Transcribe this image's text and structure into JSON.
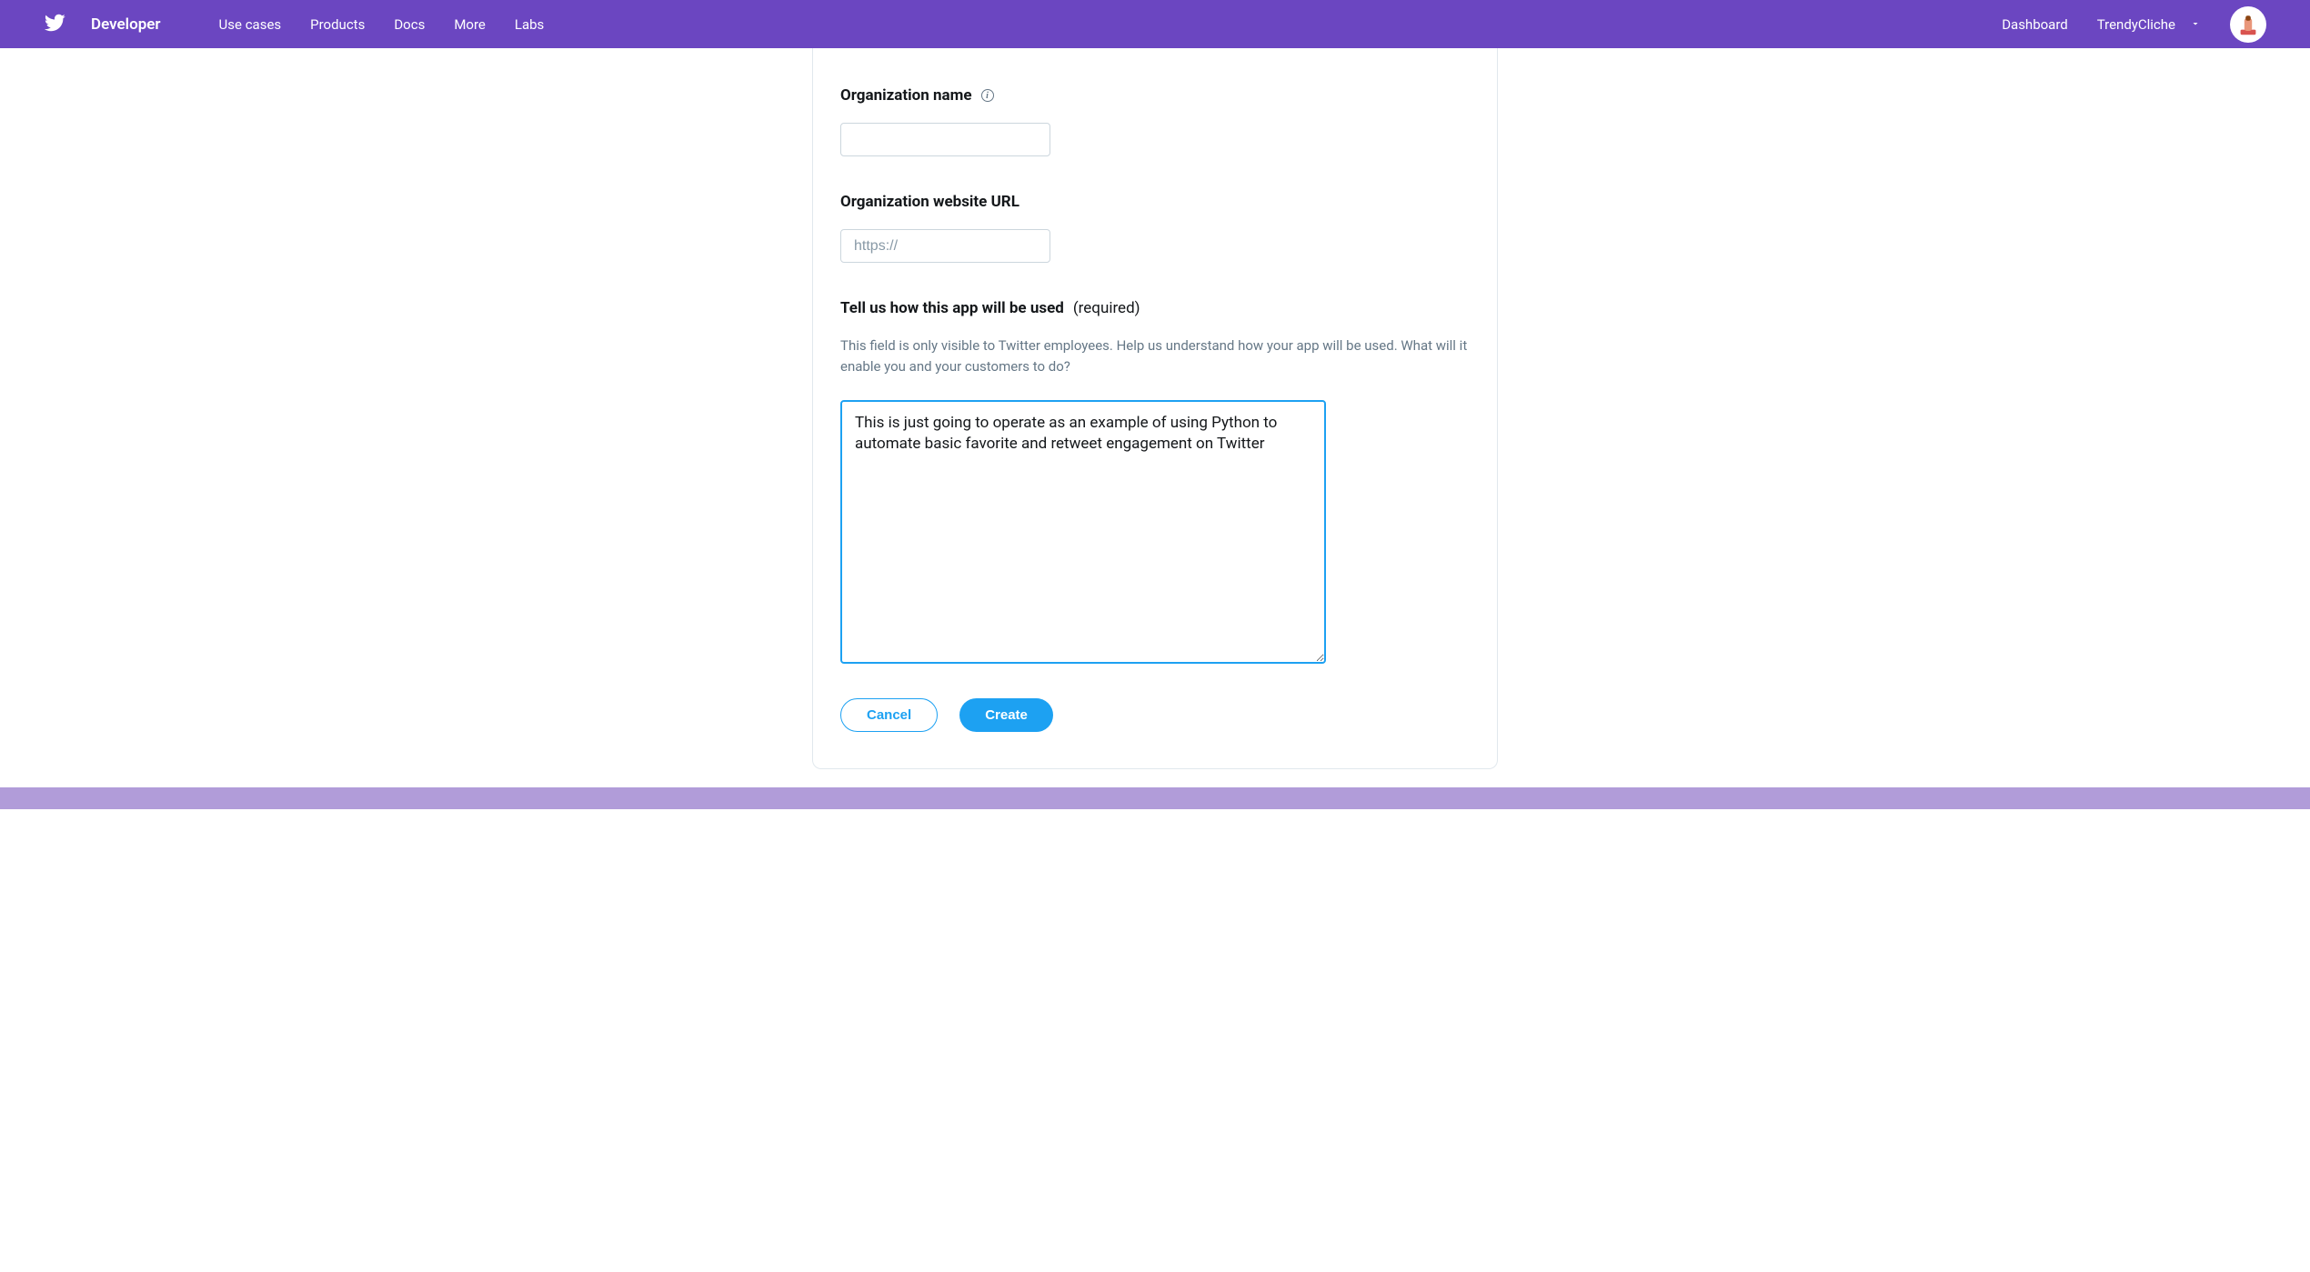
{
  "header": {
    "brand": "Developer",
    "nav": {
      "use_cases": "Use cases",
      "products": "Products",
      "docs": "Docs",
      "more": "More",
      "labs": "Labs"
    },
    "right": {
      "dashboard": "Dashboard",
      "username": "TrendyCliche"
    }
  },
  "form": {
    "org_name": {
      "label": "Organization name",
      "value": ""
    },
    "org_url": {
      "label": "Organization website URL",
      "placeholder": "https://",
      "value": ""
    },
    "app_usage": {
      "label": "Tell us how this app will be used",
      "required_text": "(required)",
      "help": "This field is only visible to Twitter employees. Help us understand how your app will be used. What will it enable you and your customers to do?",
      "value": "This is just going to operate as an example of using Python to automate basic favorite and retweet engagement on Twitter"
    },
    "buttons": {
      "cancel": "Cancel",
      "create": "Create"
    }
  }
}
